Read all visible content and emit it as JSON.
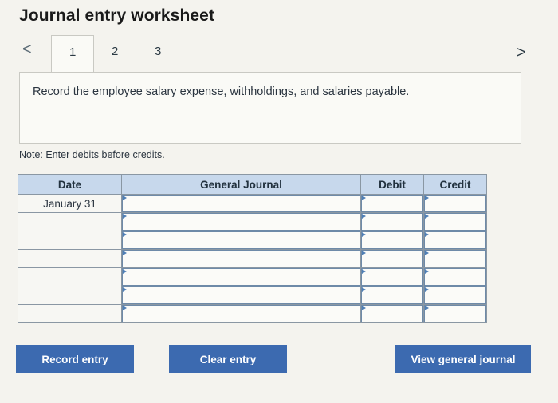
{
  "title": "Journal entry worksheet",
  "nav": {
    "prev_icon": "chevron-left-icon",
    "next_icon": "chevron-right-icon",
    "prev": "<",
    "next": ">"
  },
  "tabs": [
    {
      "label": "1"
    },
    {
      "label": "2"
    },
    {
      "label": "3"
    }
  ],
  "instruction": "Record the employee salary expense, withholdings, and salaries payable.",
  "note": "Note: Enter debits before credits.",
  "table": {
    "headers": {
      "date": "Date",
      "general_journal": "General Journal",
      "debit": "Debit",
      "credit": "Credit"
    },
    "rows": [
      {
        "date": "January 31"
      },
      {
        "date": ""
      },
      {
        "date": ""
      },
      {
        "date": ""
      },
      {
        "date": ""
      },
      {
        "date": ""
      },
      {
        "date": ""
      }
    ]
  },
  "buttons": {
    "record": "Record entry",
    "clear": "Clear entry",
    "view": "View general journal"
  },
  "colors": {
    "button": "#3c6ab0",
    "header": "#c7d8ec"
  }
}
